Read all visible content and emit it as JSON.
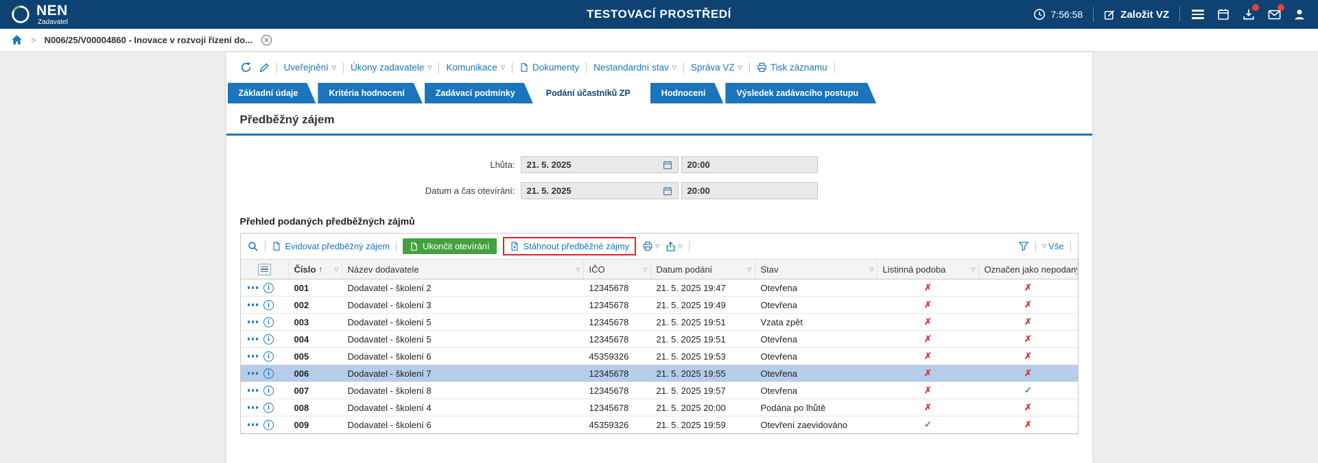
{
  "colors": {
    "topbar": "#0d4273",
    "accent": "#1b75bc",
    "green": "#44a13d",
    "red": "#d8342c",
    "check": "#2fa052",
    "selected": "#b5cde8",
    "annotation": "#ed1c24"
  },
  "topbar": {
    "brand": "NEN",
    "brand_sub": "Zadavatel",
    "environment": "TESTOVACÍ PROSTŘEDÍ",
    "time": "7:56:58",
    "create_vz": "Založit VZ"
  },
  "breadcrumb": {
    "item": "N006/25/V00004860 - Inovace v rozvoji řízení do..."
  },
  "toolbar": {
    "items": [
      "Uveřejnění",
      "Úkony zadavatele",
      "Komunikace",
      "Dokumenty",
      "Nestandardní stav",
      "Správa VZ",
      "Tisk záznamu"
    ]
  },
  "tabs": [
    {
      "label": "Základní údaje",
      "active": false
    },
    {
      "label": "Kritéria hodnocení",
      "active": false
    },
    {
      "label": "Zadávací podmínky",
      "active": false
    },
    {
      "label": "Podání účastníků ZP",
      "active": true
    },
    {
      "label": "Hodnocení",
      "active": false
    },
    {
      "label": "Výsledek zadávacího postupu",
      "active": false
    }
  ],
  "section": {
    "title": "Předběžný zájem"
  },
  "form": {
    "rows": [
      {
        "label": "Lhůta:",
        "date": "21. 5. 2025",
        "time": "20:00"
      },
      {
        "label": "Datum a čas otevírání:",
        "date": "21. 5. 2025",
        "time": "20:00"
      }
    ]
  },
  "table": {
    "heading": "Přehled podaných předběžných zájmů",
    "toolbar": {
      "evidovat": "Evidovat předběžný zájem",
      "ukoncit": "Ukončit otevírání",
      "stahnout": "Stáhnout předběžné zájmy",
      "vse": "Vše"
    },
    "columns": [
      {
        "label": "Číslo",
        "sorted": "asc",
        "filter": true
      },
      {
        "label": "Název dodavatele",
        "filter": true
      },
      {
        "label": "IČO",
        "filter": true
      },
      {
        "label": "Datum podání",
        "filter": true
      },
      {
        "label": "Stav",
        "filter": true
      },
      {
        "label": "Listinná podoba",
        "filter": true
      },
      {
        "label": "Označen jako nepodaný",
        "filter": false
      }
    ],
    "rows": [
      {
        "cislo": "001",
        "nazev": "Dodavatel - školení 2",
        "ico": "12345678",
        "datum": "21. 5. 2025 19:47",
        "stav": "Otevřena",
        "listinna": false,
        "nepodany": false,
        "selected": false
      },
      {
        "cislo": "002",
        "nazev": "Dodavatel - školení 3",
        "ico": "12345678",
        "datum": "21. 5. 2025 19:49",
        "stav": "Otevřena",
        "listinna": false,
        "nepodany": false,
        "selected": false
      },
      {
        "cislo": "003",
        "nazev": "Dodavatel - školení 5",
        "ico": "12345678",
        "datum": "21. 5. 2025 19:51",
        "stav": "Vzata zpět",
        "listinna": false,
        "nepodany": false,
        "selected": false
      },
      {
        "cislo": "004",
        "nazev": "Dodavatel - školení 5",
        "ico": "12345678",
        "datum": "21. 5. 2025 19:51",
        "stav": "Otevřena",
        "listinna": false,
        "nepodany": false,
        "selected": false
      },
      {
        "cislo": "005",
        "nazev": "Dodavatel - školení 6",
        "ico": "45359326",
        "datum": "21. 5. 2025 19:53",
        "stav": "Otevřena",
        "listinna": false,
        "nepodany": false,
        "selected": false
      },
      {
        "cislo": "006",
        "nazev": "Dodavatel - školení 7",
        "ico": "12345678",
        "datum": "21. 5. 2025 19:55",
        "stav": "Otevřena",
        "listinna": false,
        "nepodany": false,
        "selected": true
      },
      {
        "cislo": "007",
        "nazev": "Dodavatel - školení 8",
        "ico": "12345678",
        "datum": "21. 5. 2025 19:57",
        "stav": "Otevřena",
        "listinna": false,
        "nepodany": true,
        "selected": false
      },
      {
        "cislo": "008",
        "nazev": "Dodavatel - školení 4",
        "ico": "12345678",
        "datum": "21. 5. 2025 20:00",
        "stav": "Podána po lhůtě",
        "listinna": false,
        "nepodany": false,
        "selected": false
      },
      {
        "cislo": "009",
        "nazev": "Dodavatel - školení 6",
        "ico": "45359326",
        "datum": "21. 5. 2025 19:59",
        "stav": "Otevření zaevidováno",
        "listinna": true,
        "nepodany": false,
        "selected": false
      }
    ]
  }
}
